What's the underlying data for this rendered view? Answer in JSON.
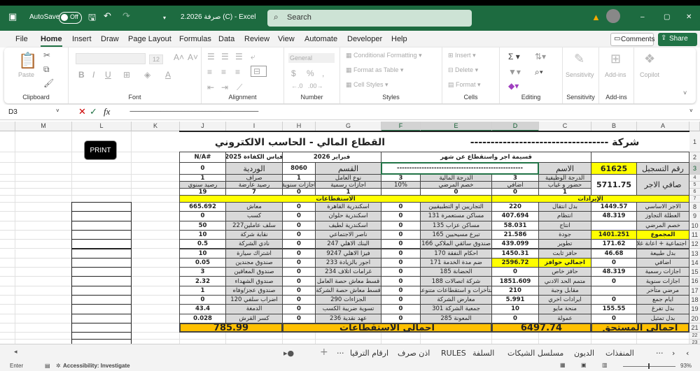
{
  "titlebar": {
    "autosave_label": "AutoSave",
    "autosave_state": "Off",
    "document_title": "2.2026 صرفة (C)  -  Excel",
    "search_placeholder": "Search"
  },
  "menu": {
    "items": [
      "File",
      "Home",
      "Insert",
      "Draw",
      "Page Layout",
      "Formulas",
      "Data",
      "Review",
      "View",
      "Automate",
      "Developer",
      "Help"
    ],
    "active": "Home",
    "comments_label": "Comments",
    "share_label": "Share"
  },
  "ribbon": {
    "paste_label": "Paste",
    "font_size": "12",
    "number_format": "General",
    "conditional_formatting": "Conditional Formatting",
    "format_as_table": "Format as Table",
    "cell_styles": "Cell Styles",
    "insert": "Insert",
    "delete": "Delete",
    "format": "Format",
    "sensitivity": "Sensitivity",
    "add_ins": "Add-ins",
    "copilot": "Copilot",
    "groups": [
      "Clipboard",
      "Font",
      "Alignment",
      "Number",
      "Styles",
      "Cells",
      "Editing",
      "Sensitivity",
      "Add-ins"
    ]
  },
  "formula_bar": {
    "name_box": "D3",
    "formula": "--------------------------------------------------------------------------------------------"
  },
  "colors": {
    "accent": "#217346",
    "label_fill": "#d9d9d9",
    "highlight": "#ffff00",
    "total_fill": "#ffc000"
  },
  "sheet": {
    "columns": [
      "M",
      "L",
      "K",
      "J",
      "I",
      "H",
      "G",
      "F",
      "E",
      "D",
      "C",
      "B",
      "A"
    ],
    "selected_cell": "D3",
    "print_button": "PRINT",
    "header_cells": [
      {
        "r": 1,
        "col": "A",
        "span": 5,
        "text": "شركة ----------------------------------",
        "fill": "title"
      },
      {
        "r": 1,
        "col": "F",
        "span": 5,
        "text": "القطاع المالي - الحاسب الالكتروني",
        "fill": "title"
      },
      {
        "r": 2,
        "col": "A",
        "span": 2,
        "text": "",
        "fill": "white"
      },
      {
        "r": 2,
        "col": "C",
        "span": 4,
        "text": "قسيمة اجر  واستقطاع عن شهر",
        "fill": "white"
      },
      {
        "r": 2,
        "col": "G",
        "span": 2,
        "text": "فبراير 2026",
        "fill": "white"
      },
      {
        "r": 2,
        "col": "I",
        "text": "قياس الكفاءة 2025",
        "fill": "white"
      },
      {
        "r": 2,
        "col": "J",
        "text": "#N/A",
        "fill": "white"
      },
      {
        "r": 3,
        "col": "A",
        "text": "رقم التسجيل",
        "fill": "gray",
        "big": true
      },
      {
        "r": 3,
        "col": "B",
        "text": "61625",
        "fill": "yellow",
        "big": true
      },
      {
        "r": 3,
        "col": "C",
        "text": "الاسم",
        "fill": "gray",
        "big": true
      },
      {
        "r": 3,
        "col": "D",
        "span": 3,
        "text": "---------------------------------------------------",
        "fill": "white"
      },
      {
        "r": 3,
        "col": "G",
        "text": "القسم",
        "fill": "gray",
        "big": true
      },
      {
        "r": 3,
        "col": "H",
        "text": "8060",
        "fill": "white"
      },
      {
        "r": 3,
        "col": "I",
        "text": "الوردية",
        "fill": "gray",
        "big": true
      },
      {
        "r": 3,
        "col": "J",
        "text": "0",
        "fill": "white"
      },
      {
        "r": 4,
        "col": "A",
        "rows": 3,
        "text": "صافي الاجر",
        "fill": "gray",
        "big": true
      },
      {
        "r": 4,
        "col": "B",
        "rows": 3,
        "text": "5711.75",
        "fill": "white",
        "big": true
      },
      {
        "r": 4,
        "col": "C",
        "text": "الدرجة الوظيفية",
        "fill": "gray"
      },
      {
        "r": 4,
        "col": "D",
        "text": "3",
        "fill": "white"
      },
      {
        "r": 4,
        "col": "E",
        "text": "الدرجة المالية",
        "fill": "gray"
      },
      {
        "r": 4,
        "col": "F",
        "text": "3",
        "fill": "white"
      },
      {
        "r": 4,
        "col": "G",
        "text": "نوع العامل",
        "fill": "gray"
      },
      {
        "r": 4,
        "col": "H",
        "text": "1",
        "fill": "white"
      },
      {
        "r": 4,
        "col": "I",
        "text": "صراف",
        "fill": "gray"
      },
      {
        "r": 4,
        "col": "J",
        "text": "1",
        "fill": "white"
      },
      {
        "r": 5,
        "col": "C",
        "text": "حضور و غياب",
        "fill": "gray"
      },
      {
        "r": 5,
        "col": "D",
        "text": "اضافي",
        "fill": "gray"
      },
      {
        "r": 5,
        "col": "E",
        "text": "خصم المرضي",
        "fill": "gray"
      },
      {
        "r": 5,
        "col": "F",
        "text": "10%",
        "fill": "gray"
      },
      {
        "r": 5,
        "col": "G",
        "text": "اجازات رسمية",
        "fill": "gray"
      },
      {
        "r": 5,
        "col": "H",
        "text": "اجازات سنوية",
        "fill": "gray"
      },
      {
        "r": 5,
        "col": "I",
        "text": "رصيد عارضة",
        "fill": "gray"
      },
      {
        "r": 5,
        "col": "J",
        "text": "رصيد سنوي",
        "fill": "gray"
      },
      {
        "r": 6,
        "col": "C",
        "text": "1",
        "fill": "white"
      },
      {
        "r": 6,
        "col": "D",
        "text": "0",
        "fill": "white"
      },
      {
        "r": 6,
        "col": "E",
        "text": "0",
        "fill": "white"
      },
      {
        "r": 6,
        "col": "F",
        "text": "",
        "fill": "white"
      },
      {
        "r": 6,
        "col": "G",
        "text": "1",
        "fill": "white"
      },
      {
        "r": 6,
        "col": "H",
        "text": "0",
        "fill": "white"
      },
      {
        "r": 6,
        "col": "I",
        "text": "7",
        "fill": "white"
      },
      {
        "r": 6,
        "col": "J",
        "text": "19",
        "fill": "white"
      },
      {
        "r": 7,
        "col": "A",
        "span": 4,
        "text": "الإيرادات",
        "fill": "yellow"
      },
      {
        "r": 7,
        "col": "E",
        "span": 6,
        "text": "الاستقطاعات",
        "fill": "yellow"
      },
      {
        "r": 21,
        "col": "A",
        "span": 2,
        "text": "اجمالي المستحق",
        "fill": "orange"
      },
      {
        "r": 21,
        "col": "C",
        "span": 2,
        "text": "6497.74",
        "fill": "orange"
      },
      {
        "r": 21,
        "col": "E",
        "span": 4,
        "text": "اجمالي الاستقطاعات",
        "fill": "orange"
      },
      {
        "r": 21,
        "col": "I",
        "span": 2,
        "text": "785.99",
        "fill": "orange"
      }
    ],
    "detail_columns": [
      "A",
      "B",
      "C",
      "D",
      "E",
      "F",
      "G",
      "H",
      "I",
      "J"
    ],
    "detail_rows": [
      [
        "الاجر الاساسي",
        "1449.57",
        "بدل انتقال",
        "220",
        "التجاريين او التطبيقيين",
        "0",
        "اسكندرية القاهرة",
        "0",
        "معاش",
        "665.692"
      ],
      [
        "العطلة التجاوز",
        "48.319",
        "انتظام",
        "407.694",
        "مساكن مستعمرة 131",
        "0",
        "اسكندرية حلوان",
        "0",
        "كسب",
        "0"
      ],
      [
        "خصم المرضي",
        "",
        "انتاج",
        "58.031",
        "مساكن عزاب 135",
        "0",
        "اسكندرية لطيف",
        "0",
        "سلف عاملين227",
        "50"
      ],
      [
        "المجموع",
        "1401.251",
        "جودة",
        "21.586",
        "تبرع مسيحيين 165",
        "0",
        "ناصر الاجتماعي",
        "0",
        "نقابة شركة",
        "10"
      ],
      [
        "ع اجتماعية + اعانة غلاء",
        "171.62",
        "تطوير",
        "439.099",
        "صندوق سائقي الملاكي 166",
        "0",
        "البنك الاهلي 247",
        "0",
        "نادي الشركة",
        "0.5"
      ],
      [
        "بدل طبيعة",
        "46.68",
        "حافز ثابت",
        "1450.31",
        "احكام النفقة 170",
        "0",
        "فيزا الاهلي 9247",
        "0",
        "اشتراك سيارة",
        "10"
      ],
      [
        "اضافي",
        "0",
        "اجمالي حوافز",
        "2596.72",
        "ضم مدة الخدمة 171",
        "0",
        "اجور بالزيادة 233",
        "0",
        "صندوق مجندين",
        "0.05"
      ],
      [
        "اجازات رسمية",
        "48.319",
        "حافز خاص",
        "0",
        "الحضانة 185",
        "0",
        "غرامات اتلاف 234",
        "0",
        "صندوق المعاقين",
        "3"
      ],
      [
        "اجازات سنوية",
        "0",
        "متمم الحد الادني",
        "1851.609",
        "شركة اتصالات 188",
        "0",
        "قسط معاش حصة العامل",
        "0",
        "صندوق الشهداء",
        "2.32"
      ],
      [
        "مرضي متأخر",
        "",
        "مقابل وجبة",
        "210",
        "متأخرات و استقطاعات متنوعة",
        "0",
        "قسط معاش حصة الشركة",
        "0",
        "صندوق عجز/وفاه",
        "1"
      ],
      [
        "ايام جمع",
        "0",
        "ايرادات اخري",
        "5.991",
        "معارض الشركة",
        "0",
        "الجزاءات 290",
        "0",
        "اضراب سلفي 120",
        "0"
      ],
      [
        "بدل تفرغ",
        "155.55",
        "منحة مايو",
        "10",
        "جمعية الشركة 301",
        "0",
        "تسوية ضريبة الكسب",
        "0",
        "الدمغة",
        "43.4"
      ],
      [
        "بدل تمثيل",
        "0",
        "عمولة",
        "0",
        "المعونة 285",
        "0",
        "عهد نقدية 236",
        "0",
        "كسر القرش",
        "0.028"
      ]
    ],
    "highlighted_cells": [
      "A11",
      "B11",
      "C14",
      "D14"
    ]
  },
  "sheet_tabs": {
    "tabs": [
      "المنفذات",
      "الديون",
      "مسلسل الشيكات",
      "السلفة",
      "RULES",
      "اذن صرف",
      "ارقام الترقيا"
    ],
    "more": "···",
    "add": "+"
  },
  "status": {
    "mode": "Enter",
    "accessibility": "Accessibility: Investigate",
    "zoom": "93%"
  }
}
